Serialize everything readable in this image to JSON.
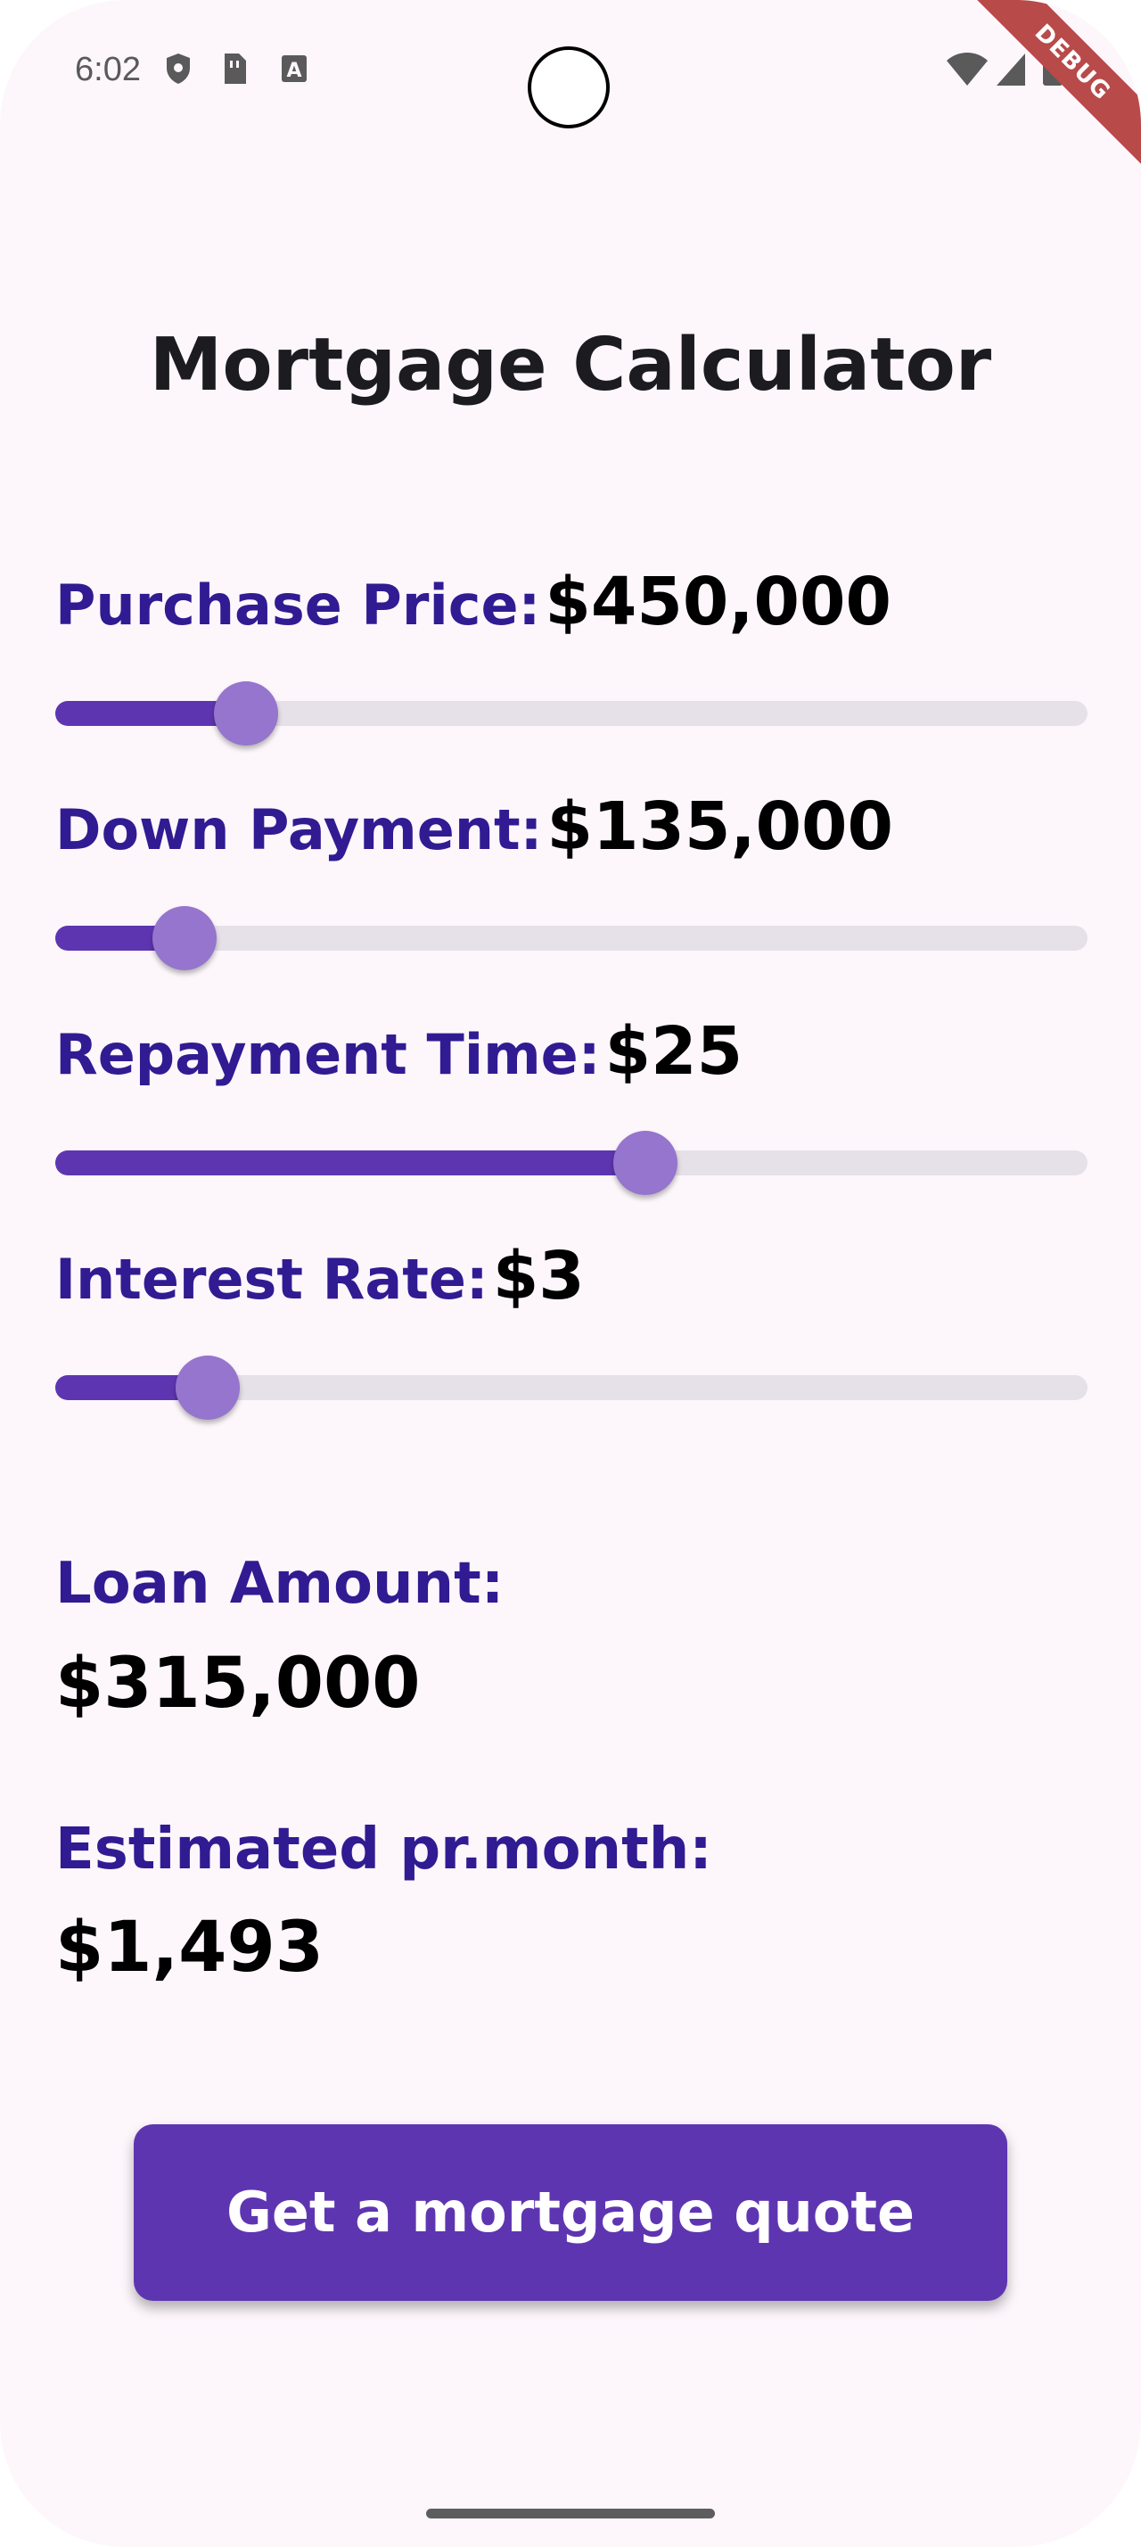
{
  "status_bar": {
    "time": "6:02",
    "icons_left": [
      "shield-icon",
      "sim-card-icon",
      "font-a-icon"
    ],
    "icons_right": [
      "wifi-icon",
      "cell-signal-icon",
      "battery-icon"
    ]
  },
  "debug_banner": "DEBUG",
  "page": {
    "title": "Mortgage Calculator"
  },
  "fields": [
    {
      "label": "Purchase Price:",
      "value": "$450,000",
      "slider_fraction": 0.185
    },
    {
      "label": "Down Payment:",
      "value": "$135,000",
      "slider_fraction": 0.125
    },
    {
      "label": "Repayment Time:",
      "value": "$25",
      "slider_fraction": 0.572
    },
    {
      "label": "Interest Rate:",
      "value": "$3",
      "slider_fraction": 0.148
    }
  ],
  "results": {
    "loan_amount_label": "Loan Amount:",
    "loan_amount_value": "$315,000",
    "monthly_label": "Estimated pr.month:",
    "monthly_value": "$1,493"
  },
  "actions": {
    "quote_button": "Get a mortgage quote"
  },
  "colors": {
    "background": "#fdf7fc",
    "accent": "#5e35b1",
    "thumb": "#9575cd",
    "label": "#311b92",
    "track_inactive": "#e6e0e9"
  }
}
